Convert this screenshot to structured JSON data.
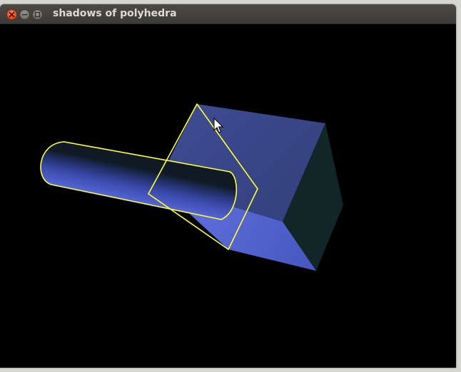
{
  "window": {
    "title": "shadows of polyhedra",
    "close_icon": "close-icon",
    "minimize_icon": "minimize-icon",
    "maximize_icon": "maximize-icon"
  },
  "scene": {
    "background": "#000000",
    "objects": [
      "cube",
      "cylinder"
    ],
    "shadow_outline_color": "#ffff33",
    "cube_front_color": "#5464cc",
    "cube_top_color": "#3a4684",
    "cube_side_color": "#112626",
    "cylinder_color": "#4a59c4",
    "cursor_icon": "mouse-pointer-icon"
  }
}
